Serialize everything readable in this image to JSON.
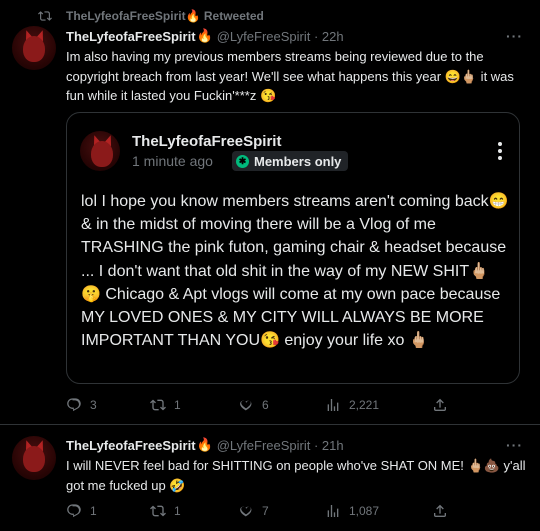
{
  "tweet1": {
    "retweet_label": "TheLyfeofaFreeSpirit🔥 Retweeted",
    "author_name": "TheLyfeofaFreeSpirit",
    "author_emoji": "🔥",
    "handle_time": "@LyfeFreeSpirit · 22h",
    "more": "···",
    "text": "Im also having my previous members streams being reviewed due to the copyright breach from last year! We'll see what happens this year 😄🖕🏼 it was fun while it lasted you Fuckin'***z 😘",
    "quote": {
      "author_name": "TheLyfeofaFreeSpirit",
      "time": "1 minute ago",
      "badge": "Members only",
      "text": "lol I hope you know members streams aren't coming back😁& in the midst of moving there will be a Vlog of me TRASHING the pink futon, gaming chair & headset because ... I don't want that old shit in the way of my NEW SHIT🖕🏼 🤫 Chicago & Apt vlogs will come at my own pace because MY LOVED ONES & MY CITY WILL ALWAYS BE MORE IMPORTANT THAN YOU😘 enjoy your life xo 🖕🏼"
    },
    "actions": {
      "replies": "3",
      "retweets": "1",
      "likes": "6",
      "views": "2,221"
    }
  },
  "tweet2": {
    "author_name": "TheLyfeofaFreeSpirit",
    "author_emoji": "🔥",
    "handle_time": "@LyfeFreeSpirit · 21h",
    "more": "···",
    "text": "I will NEVER feel bad for SHITTING on people who've SHAT ON ME! 🖕🏼💩 y'all got me fucked up 🤣",
    "actions": {
      "replies": "1",
      "retweets": "1",
      "likes": "7",
      "views": "1,087"
    }
  },
  "icons": [
    "retweet-icon",
    "more-icon",
    "members-badge-icon",
    "reply-icon",
    "like-icon",
    "views-icon",
    "share-icon"
  ],
  "colors": {
    "background": "#000000",
    "text": "#e7e9ea",
    "muted": "#71767b",
    "members_green": "#00ba7c",
    "border": "#2f3336"
  }
}
